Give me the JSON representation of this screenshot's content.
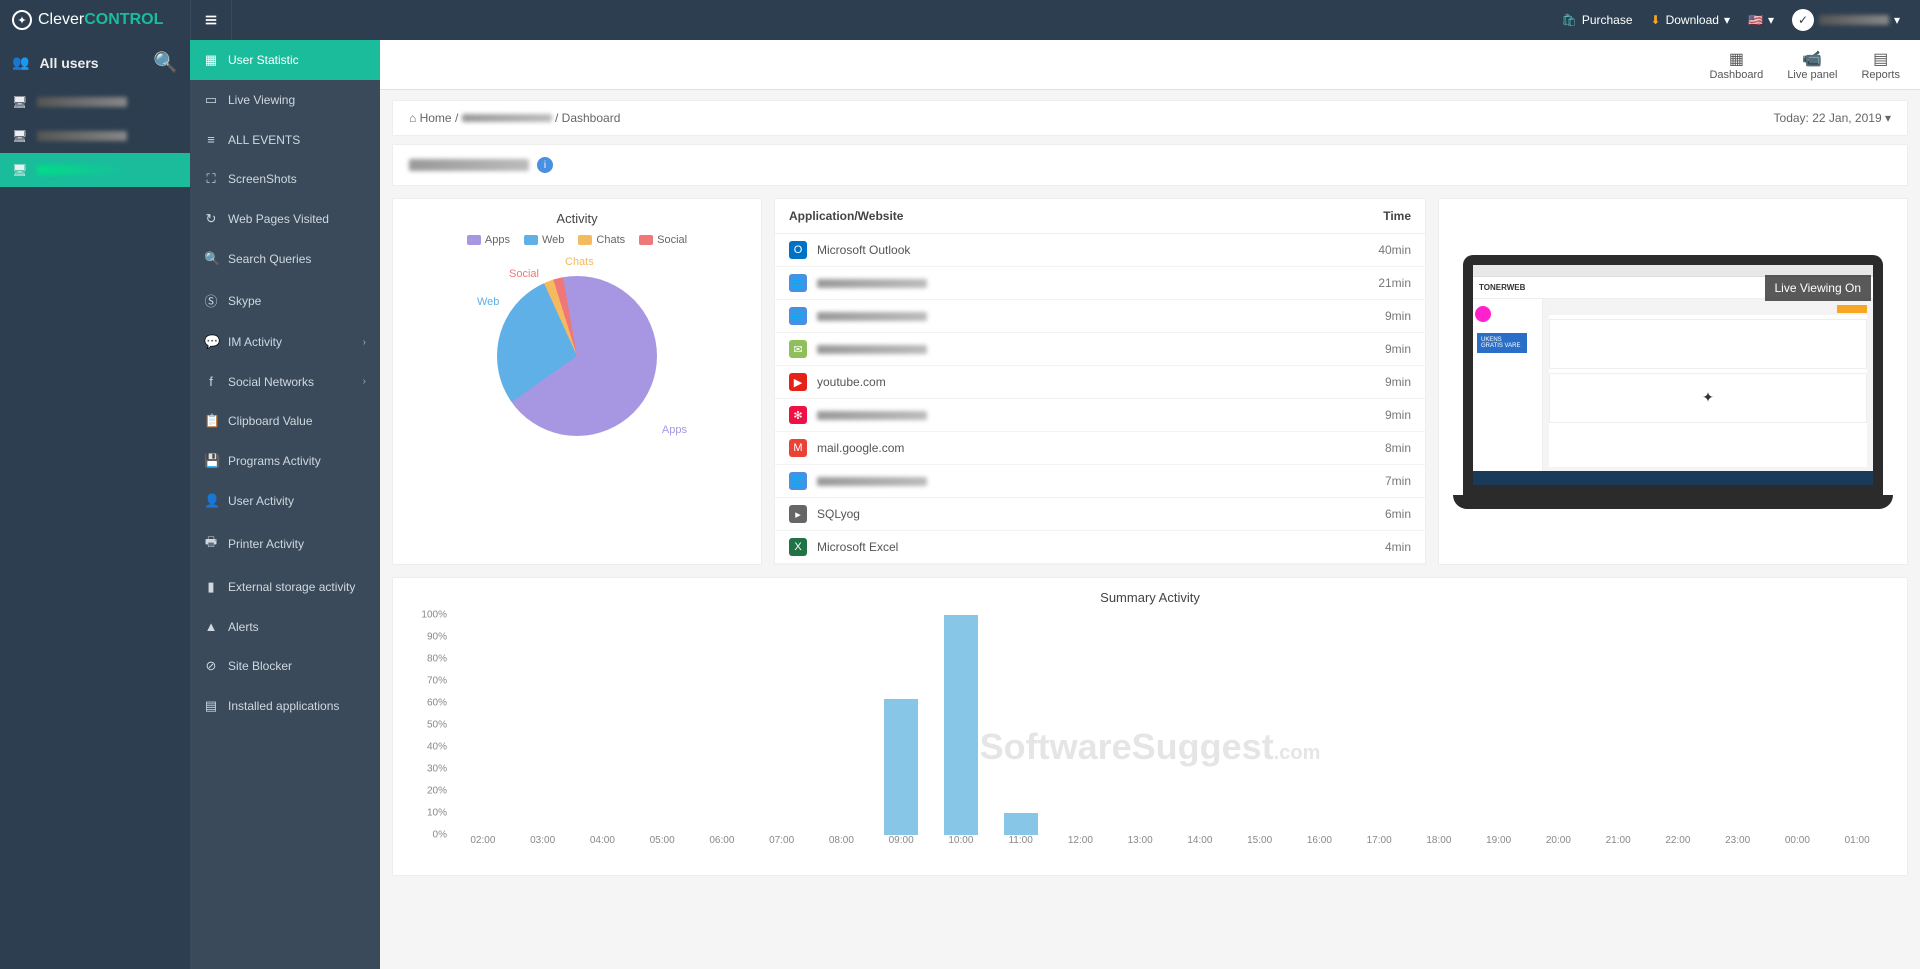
{
  "brand": {
    "part1": "Clever",
    "part2": "CONTROL"
  },
  "topbar": {
    "purchase": "Purchase",
    "download": "Download",
    "download_caret": "▾",
    "flag": "🇺🇸",
    "flag_caret": "▾",
    "user_caret": "▾"
  },
  "sidebar1": {
    "all_users": "All users"
  },
  "sidebar2": {
    "items": [
      {
        "label": "User Statistic",
        "icon": "▦",
        "active": true
      },
      {
        "label": "Live Viewing",
        "icon": "▭"
      },
      {
        "label": "ALL EVENTS",
        "icon": "≡"
      },
      {
        "label": "ScreenShots",
        "icon": "⛶"
      },
      {
        "label": "Web Pages Visited",
        "icon": "↻"
      },
      {
        "label": "Search Queries",
        "icon": "🔍"
      },
      {
        "label": "Skype",
        "icon": "Ⓢ"
      },
      {
        "label": "IM Activity",
        "icon": "💬",
        "expandable": true
      },
      {
        "label": "Social Networks",
        "icon": "f",
        "expandable": true
      },
      {
        "label": "Clipboard Value",
        "icon": "📋"
      },
      {
        "label": "Programs Activity",
        "icon": "💾"
      },
      {
        "label": "User Activity",
        "icon": "👤"
      },
      {
        "label": "Printer Activity",
        "icon": "🖶"
      },
      {
        "label": "External storage activity",
        "icon": "▮"
      },
      {
        "label": "Alerts",
        "icon": "▲"
      },
      {
        "label": "Site Blocker",
        "icon": "⊘"
      },
      {
        "label": "Installed applications",
        "icon": "▤"
      }
    ]
  },
  "toolbar": {
    "dashboard": "Dashboard",
    "live_panel": "Live panel",
    "reports": "Reports"
  },
  "breadcrumb": {
    "home": "Home",
    "sep": "/",
    "last": "Dashboard",
    "date": "Today: 22 Jan, 2019",
    "caret": "▾"
  },
  "activity": {
    "title": "Activity",
    "legend": {
      "apps": "Apps",
      "web": "Web",
      "chats": "Chats",
      "social": "Social"
    },
    "labels": {
      "apps": "Apps",
      "web": "Web",
      "chats": "Chats",
      "social": "Social"
    }
  },
  "apptable": {
    "col_app": "Application/Website",
    "col_time": "Time",
    "rows": [
      {
        "name": "Microsoft Outlook",
        "time": "40min",
        "icon": "O",
        "bg": "#0072c6",
        "blurred": false
      },
      {
        "name": "",
        "time": "21min",
        "icon": "🌐",
        "bg": "#4a90e2",
        "blurred": true
      },
      {
        "name": "",
        "time": "9min",
        "icon": "🌐",
        "bg": "#4a90e2",
        "blurred": true
      },
      {
        "name": "",
        "time": "9min",
        "icon": "✉",
        "bg": "#8fbf5a",
        "blurred": true
      },
      {
        "name": "youtube.com",
        "time": "9min",
        "icon": "▶",
        "bg": "#e62117",
        "blurred": false
      },
      {
        "name": "",
        "time": "9min",
        "icon": "✻",
        "bg": "#e14",
        "blurred": true
      },
      {
        "name": "mail.google.com",
        "time": "8min",
        "icon": "M",
        "bg": "#ea4335",
        "blurred": false
      },
      {
        "name": "",
        "time": "7min",
        "icon": "🌐",
        "bg": "#4a90e2",
        "blurred": true
      },
      {
        "name": "SQLyog",
        "time": "6min",
        "icon": "▸",
        "bg": "#666",
        "blurred": false
      },
      {
        "name": "Microsoft Excel",
        "time": "4min",
        "icon": "X",
        "bg": "#217346",
        "blurred": false
      }
    ]
  },
  "live": {
    "badge": "Live Viewing On",
    "screen_brand": "TONERWEB",
    "blue_box": "UKENS GRATIS VARE"
  },
  "summary": {
    "title": "Summary Activity"
  },
  "watermark": {
    "w1": "SoftwareSuggest",
    "w2": ".com"
  },
  "colors": {
    "apps": "#a797e3",
    "web": "#5fb0e6",
    "chats": "#f5b95f",
    "social": "#ef7777",
    "bar": "#88c6e8"
  },
  "chart_data": [
    {
      "type": "pie",
      "title": "Activity",
      "series": [
        {
          "name": "Apps",
          "value": 68,
          "color": "#a797e3"
        },
        {
          "name": "Web",
          "value": 28,
          "color": "#5fb0e6"
        },
        {
          "name": "Chats",
          "value": 2,
          "color": "#f5b95f"
        },
        {
          "name": "Social",
          "value": 2,
          "color": "#ef7777"
        }
      ]
    },
    {
      "type": "bar",
      "title": "Summary Activity",
      "ylabel": "%",
      "ylim": [
        0,
        100
      ],
      "categories": [
        "02:00",
        "03:00",
        "04:00",
        "05:00",
        "06:00",
        "07:00",
        "08:00",
        "09:00",
        "10:00",
        "11:00",
        "12:00",
        "13:00",
        "14:00",
        "15:00",
        "16:00",
        "17:00",
        "18:00",
        "19:00",
        "20:00",
        "21:00",
        "22:00",
        "23:00",
        "00:00",
        "01:00"
      ],
      "values": [
        0,
        0,
        0,
        0,
        0,
        0,
        0,
        62,
        100,
        10,
        0,
        0,
        0,
        0,
        0,
        0,
        0,
        0,
        0,
        0,
        0,
        0,
        0,
        0
      ]
    }
  ]
}
